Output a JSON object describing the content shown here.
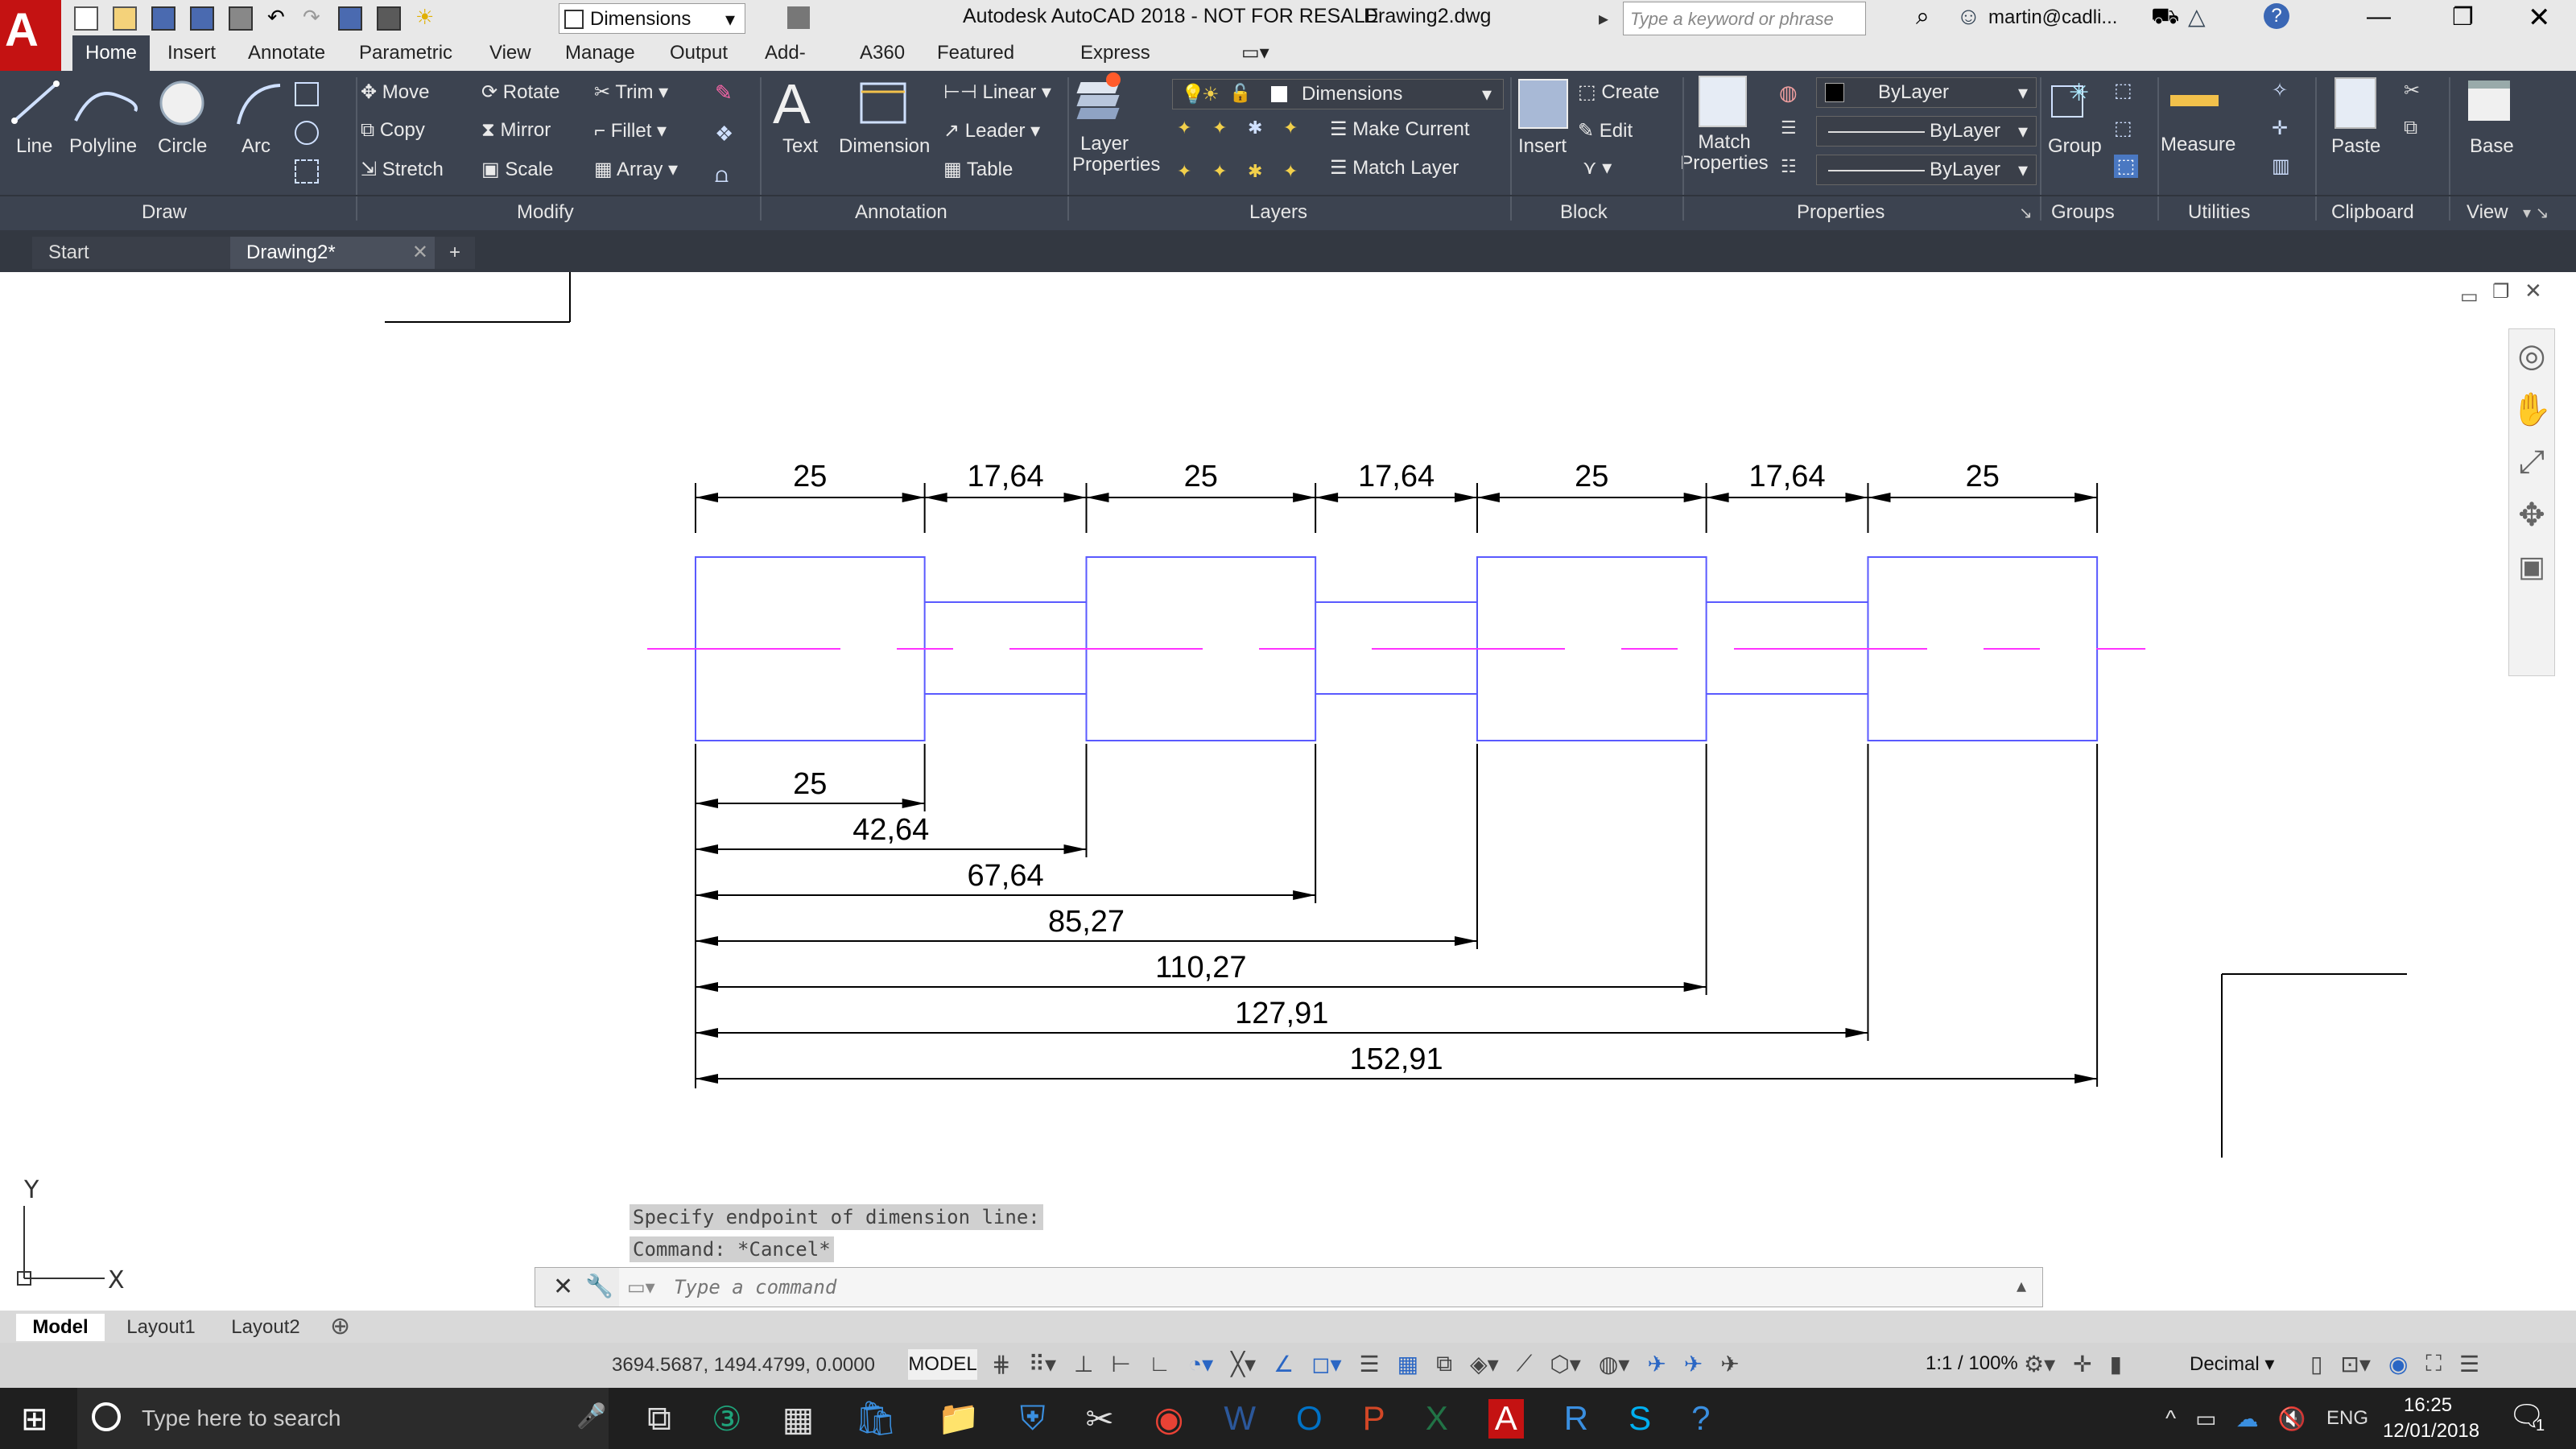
{
  "app": {
    "title": "Autodesk AutoCAD 2018 - NOT FOR RESALE",
    "filename": "Drawing2.dwg",
    "search_placeholder": "Type a keyword or phrase",
    "user": "martin@cadli...",
    "quick_dropdown": "Dimensions"
  },
  "menu_tabs": [
    "Home",
    "Insert",
    "Annotate",
    "Parametric",
    "View",
    "Manage",
    "Output",
    "Add-ins",
    "A360",
    "Featured Apps",
    "Express Tools"
  ],
  "ribbon": {
    "draw": [
      "Line",
      "Polyline",
      "Circle",
      "Arc"
    ],
    "modify": [
      "Move",
      "Rotate",
      "Trim",
      "Copy",
      "Mirror",
      "Fillet",
      "Stretch",
      "Scale",
      "Array"
    ],
    "annotation": [
      "Text",
      "Dimension",
      "Linear",
      "Leader",
      "Table"
    ],
    "layers": [
      "Layer Properties",
      "Make Current",
      "Match Layer"
    ],
    "block": [
      "Insert",
      "Create",
      "Edit"
    ],
    "properties": [
      "Match Properties",
      "ByLayer",
      "ByLayer",
      "ByLayer"
    ],
    "groups": [
      "Group"
    ],
    "utilities": [
      "Measure"
    ],
    "clipboard": [
      "Paste"
    ],
    "view": [
      "Base"
    ],
    "group_labels": [
      "Draw",
      "Modify",
      "Annotation",
      "Layers",
      "Block",
      "Properties",
      "Groups",
      "Utilities",
      "Clipboard",
      "View"
    ],
    "layer_dropdown": "Dimensions"
  },
  "doc_tabs": [
    "Start",
    "Drawing2*"
  ],
  "dimensions": {
    "top": [
      "25",
      "17,64",
      "25",
      "17,64",
      "25",
      "17,64",
      "25"
    ],
    "baseline": [
      "25",
      "42,64",
      "67,64",
      "85,27",
      "110,27",
      "127,91",
      "152,91"
    ]
  },
  "command": {
    "history1": "Specify endpoint of dimension line:",
    "history2": "Command: *Cancel*",
    "input_placeholder": "Type a command"
  },
  "layout_tabs": [
    "Model",
    "Layout1",
    "Layout2"
  ],
  "status": {
    "coords": "3694.5687, 1494.4799, 0.0000",
    "mode": "MODEL",
    "scale": "1:1 / 100%",
    "units": "Decimal"
  },
  "taskbar": {
    "search_placeholder": "Type here to search",
    "lang": "ENG",
    "time": "16:25",
    "date": "12/01/2018",
    "notifications": "1"
  },
  "colors": {
    "ribbon_bg": "#3c4350",
    "geometry": "#5a5aff",
    "centerline": "#ff33ff",
    "dim": "#000000"
  }
}
